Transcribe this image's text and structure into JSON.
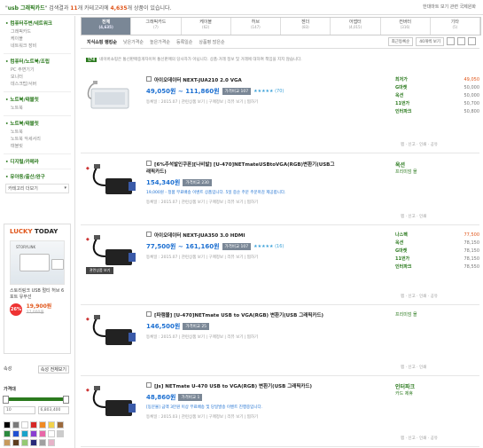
{
  "header": {
    "query_prefix": "\"",
    "query_term": "usb 그래픽카드",
    "query_suffix": "\" 검색결과 ",
    "cat_count": "11",
    "cat_mid": "개 카테고리에 ",
    "item_count": "4,635",
    "item_suffix": "개 상품이 있습니다.",
    "options_label": "한대마트 보기 관련 국제원화"
  },
  "sidebar": {
    "groups": [
      {
        "title": "• 컴퓨터주변/네트워크",
        "items": [
          "그래픽카드",
          "케이블",
          "네트워크 장비"
        ]
      },
      {
        "title": "• 컴퓨터/노트북/조립",
        "items": [
          "PC 주변기기",
          "모니터",
          "데스크탑/서버"
        ]
      },
      {
        "title": "• 노트북/태블릿",
        "items": [
          "노트북"
        ]
      },
      {
        "title": "• 노트북/태블릿",
        "items": [
          "노트북",
          "노트북 악세서리",
          "태블릿"
        ]
      },
      {
        "title": "• 디지털/카메라",
        "items": []
      },
      {
        "title": "• 유아동/출산/완구",
        "items": []
      }
    ],
    "more_label": "카테고리 더보기",
    "lucky": {
      "title_a": "LUCKY",
      "title_b": " TODAY",
      "brand": "STORYLINK",
      "name": "스토리링크 USB 멀티 허브 6포트 유무선",
      "discount": "26%",
      "price": "19,900원",
      "old_price": "27,000원"
    },
    "filter": {
      "tab_a": "속성",
      "tab_b": "속성 전체보기",
      "price_label": "가격대",
      "min": "10",
      "max": "6,803,400",
      "low_fraction": 0.02,
      "high_fraction": 0.96,
      "swatches": [
        "#000000",
        "#7a7a7a",
        "#ffffff",
        "#d62828",
        "#f08a24",
        "#f2d24b",
        "#9c6a3c",
        "#2b8a3e",
        "#1f4fd1",
        "#1aa3c9",
        "#8a3fd1",
        "#e867a8",
        "#ffffff",
        "#cccccc",
        "#c79a5c",
        "#5c3c1e",
        "#94c973",
        "#2a2a7a",
        "#a0a0a0",
        "#e6b3c8"
      ]
    }
  },
  "categories": [
    {
      "label": "전체",
      "count": "(4,635)",
      "active": true
    },
    {
      "label": "그래픽카드",
      "count": "(7)"
    },
    {
      "label": "케이블",
      "count": "(62)"
    },
    {
      "label": "허브",
      "count": "(147)"
    },
    {
      "label": "젠더",
      "count": "(83)"
    },
    {
      "label": "어댑터",
      "count": "(4,015)"
    },
    {
      "label": "컨버터",
      "count": "(316)"
    },
    {
      "label": "기타",
      "count": "(5)"
    }
  ],
  "sort": {
    "items": [
      "지식쇼핑 랭킹순",
      "낮은가격순",
      "높은가격순",
      "등록일순",
      "상품평 많은순"
    ],
    "dropdown_a": "최근등록순",
    "dropdown_b": "40개씩 보기"
  },
  "notice": {
    "badge": "안내",
    "text": "네이버쇼핑은 통신판매중개자이며 통신판매의 당사자가 아닙니다. 상품·거래 정보 및 거래에 대하여 책임을 지지 않습니다."
  },
  "products": [
    {
      "title": "아이오데이터 NEXT-JUA210 2.0 VGA",
      "price": "49,050원 ~ 111,860원",
      "btn": "가격비교 107",
      "stars": "★★★★★ (70)",
      "spec": "",
      "meta": "등록일 : 2015.07 | 관련상품 보기 | 구매정보 | 리뷰 보기 | 찜하기",
      "mall_rows": [
        {
          "name": "최저가",
          "price": "49,050"
        },
        {
          "name": "G마켓",
          "price": "50,000"
        },
        {
          "name": "옥션",
          "price": "50,000"
        },
        {
          "name": "11번가",
          "price": "50,700"
        },
        {
          "name": "인터파크",
          "price": "50,800"
        }
      ],
      "acts": "찜  ·  신고  ·  인쇄  ·  공유"
    },
    {
      "title": "[6%추석발인쿠폰][나비발] [U-470]NETmateUSBtoVGA(RGB)변환기(USB그래픽카드)",
      "price": "154,340원",
      "btn": "가격비교 230",
      "stars": "",
      "spec": "19,000원 - 정품 무료배송 이벤트 상품입니다. 5일 중순 주문 주문마감 제공합니다.",
      "meta": "등록일 : 2015.07 | 관련상품 보기 | 구매정보 | 리뷰 보기 | 찜하기",
      "shop": "옥션",
      "shop2": "프리미엄 몰",
      "acts": "찜  ·  신고  ·  인쇄"
    },
    {
      "title": "아이오데이터 NEXT-JUA350 3.0 HDMI",
      "price": "77,500원 ~ 161,160원",
      "btn": "가격비교 107",
      "stars": "★★★★★ (16)",
      "spec": "",
      "meta": "등록일 : 2015.07 | 관련상품 보기 | 구매정보 | 리뷰 보기 | 찜하기",
      "ribbon": "관련상품 보기",
      "mall_rows": [
        {
          "name": "나스펙",
          "price": "77,500"
        },
        {
          "name": "옥션",
          "price": "78,150"
        },
        {
          "name": "G마켓",
          "price": "78,150"
        },
        {
          "name": "11번가",
          "price": "78,150"
        },
        {
          "name": "인터파크",
          "price": "78,550"
        }
      ],
      "acts": "찜  ·  신고  ·  인쇄  ·  공유"
    },
    {
      "title": "[파캠몰] [U-470]NETmate USB to VGA(RGB) 변환기(USB 그래픽카드)",
      "price": "146,500원",
      "btn": "가격비교 25",
      "stars": "",
      "spec": "",
      "meta": "등록일 : 2015.07 | 관련상품 보기 | 구매정보 | 리뷰 보기 | 찜하기",
      "shop": "",
      "shop2": "프리미엄 몰",
      "acts": "찜  ·  신고  ·  인쇄"
    },
    {
      "title": "[Js] NETmate U-470 USB to VGA(RGB) 변환기(USB 그래픽카드)",
      "price": "48,860원",
      "btn": "가격비교 1",
      "stars": "",
      "spec": "[동문몰] 금액 3만원 이상 무료배송 및 당일발송 이벤트 진행중입니다.",
      "meta": "등록일 : 2015.03 | 관련상품 보기 | 구매정보 | 리뷰 보기 | 찜하기",
      "shop": "인터파크",
      "shop2": "카드 제휴",
      "acts": "찜  ·  신고  ·  인쇄  ·  공유"
    }
  ]
}
